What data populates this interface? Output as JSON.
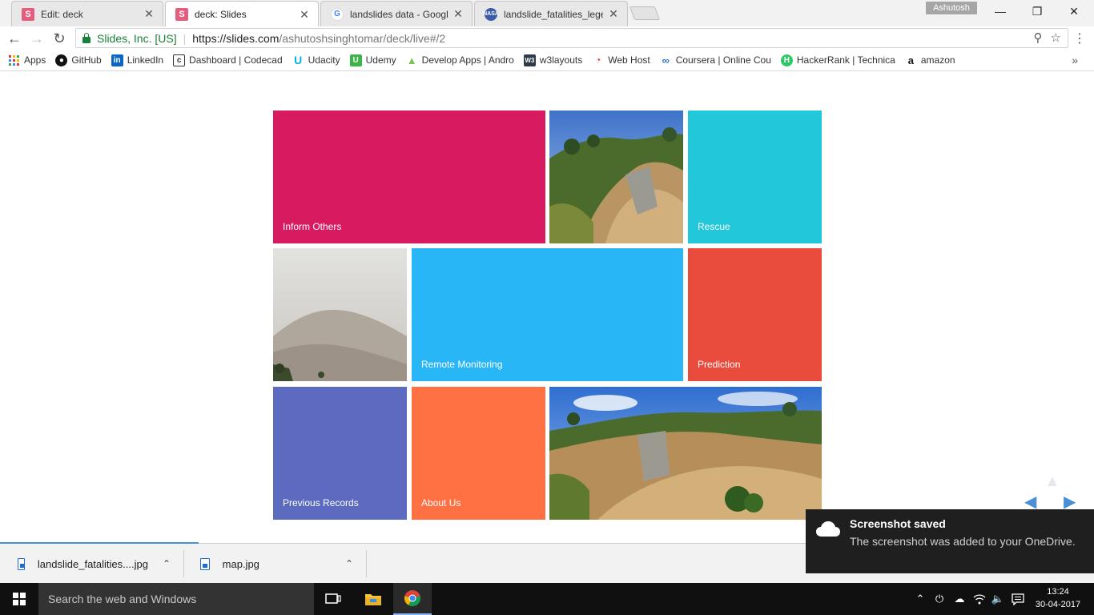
{
  "browser": {
    "user": "Ashutosh",
    "tabs": [
      {
        "label": "Edit: deck",
        "icon": "slides-icon",
        "active": false
      },
      {
        "label": "deck: Slides",
        "icon": "slides-icon",
        "active": true
      },
      {
        "label": "landslides data - Google",
        "icon": "google-icon",
        "active": false
      },
      {
        "label": "landslide_fatalities_legen",
        "icon": "nasa-icon",
        "active": false
      }
    ],
    "favicon_letters": {
      "slides": "S",
      "google": "G",
      "nasa": "NASA"
    },
    "address": {
      "secure_label": "Slides, Inc. [US]",
      "url_host": "https://slides.com",
      "url_path": "/ashutoshsinghtomar/deck/live#/2"
    },
    "bookmarks": [
      {
        "label": "Apps",
        "icon": "apps-grid-icon"
      },
      {
        "label": "GitHub",
        "icon": "github-icon"
      },
      {
        "label": "LinkedIn",
        "icon": "linkedin-icon"
      },
      {
        "label": "Dashboard | Codecad",
        "icon": "codecademy-icon"
      },
      {
        "label": "Udacity",
        "icon": "udacity-icon"
      },
      {
        "label": "Udemy",
        "icon": "udemy-icon"
      },
      {
        "label": "Develop Apps | Andro",
        "icon": "android-icon"
      },
      {
        "label": "w3layouts",
        "icon": "w3layouts-icon"
      },
      {
        "label": "Web Host",
        "icon": "webhost-icon"
      },
      {
        "label": "Coursera | Online Cou",
        "icon": "coursera-icon"
      },
      {
        "label": "HackerRank | Technica",
        "icon": "hackerrank-icon"
      },
      {
        "label": "amazon",
        "icon": "amazon-icon"
      }
    ]
  },
  "slide": {
    "tiles": [
      {
        "label": "Inform Others",
        "color": "#d81b60"
      },
      {
        "label": "Rescue",
        "color": "#22c7da"
      },
      {
        "label": "Remote Monitoring",
        "color": "#29b6f6"
      },
      {
        "label": "Prediction",
        "color": "#e94c3d"
      },
      {
        "label": "Previous Records",
        "color": "#5c6bc0"
      },
      {
        "label": "About Us",
        "color": "#ff7043"
      }
    ]
  },
  "downloads": [
    {
      "filename": "landslide_fatalities....jpg"
    },
    {
      "filename": "map.jpg"
    }
  ],
  "toast": {
    "title": "Screenshot saved",
    "body": "The screenshot was added to your OneDrive."
  },
  "taskbar": {
    "search_placeholder": "Search the web and Windows",
    "time": "13:24",
    "date": "30-04-2017"
  }
}
